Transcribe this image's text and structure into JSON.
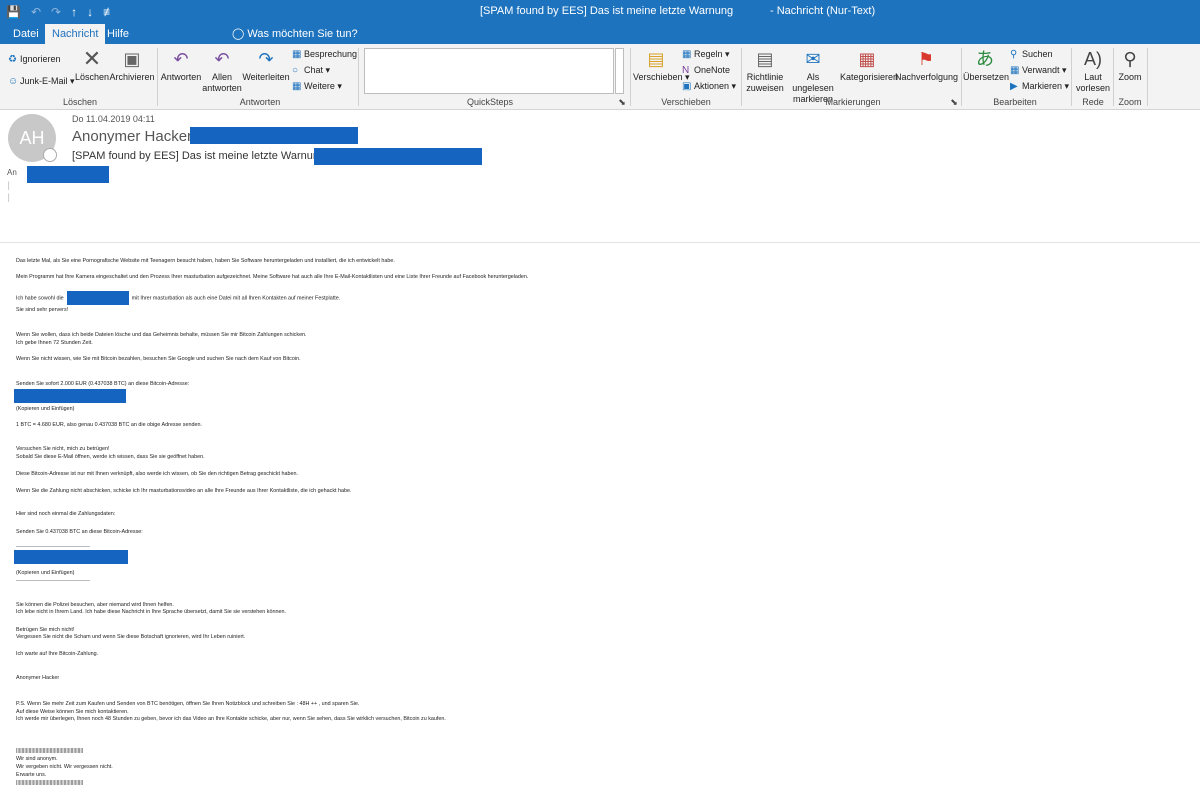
{
  "window": {
    "title_left": "[SPAM found by EES] Das ist meine letzte Warnung",
    "title_right": "-  Nachricht (Nur-Text)"
  },
  "qat": {
    "save": "💾",
    "undo": "↶",
    "redo": "↷",
    "up": "↑",
    "down": "↓",
    "more": "≢"
  },
  "menu": {
    "tabs": [
      "Datei",
      "Nachricht",
      "Hilfe"
    ],
    "tellme": "Was möchten Sie tun?"
  },
  "ribbon": {
    "loeschen": {
      "ignore": "Ignorieren",
      "junk": "Junk-E-Mail",
      "delete": "Löschen",
      "archive": "Archivieren",
      "label": "Löschen"
    },
    "antworten": {
      "reply": "Antworten",
      "reply_all": "Allen antworten",
      "forward": "Weiterleiten",
      "meeting": "Besprechung",
      "chat": "Chat",
      "more": "Weitere",
      "label": "Antworten"
    },
    "quicksteps": {
      "label": "QuickSteps"
    },
    "verschieben": {
      "move": "Verschieben",
      "rules": "Regeln",
      "onenote": "OneNote",
      "actions": "Aktionen",
      "label": "Verschieben"
    },
    "markierungen": {
      "policy": "Richtlinie zuweisen",
      "unread": "Als ungelesen markieren",
      "categorize": "Kategorisieren",
      "followup": "Nachverfolgung",
      "label": "Markierungen"
    },
    "bearbeiten": {
      "translate": "Übersetzen",
      "find": "Suchen",
      "related": "Verwandt",
      "select": "Markieren",
      "label": "Bearbeiten"
    },
    "rede": {
      "read_aloud": "Laut vorlesen",
      "label": "Rede"
    },
    "zoom": {
      "zoom": "Zoom",
      "label": "Zoom"
    }
  },
  "message": {
    "avatar_initials": "AH",
    "date": "Do 11.04.2019 04:11",
    "sender": "Anonymer Hacker",
    "subject": "[SPAM found by EES] Das ist meine letzte Warnung",
    "to_label": "An",
    "body": {
      "l1": "Das letzte Mal, als Sie eine Pornografische Website mit Teenagern besucht haben, haben Sie Software heruntergeladen und installiert, die ich entwickelt habe.",
      "l2": "Mein Programm hat Ihre Kamera eingeschaltet und den Prozess Ihrer masturbation aufgezeichnet. Meine Software hat auch alle Ihre E-Mail-Kontaktlisten und eine Liste Ihrer Freunde auf Facebook heruntergeladen.",
      "l3a": "Ich habe sowohl die",
      "l3b": "mit Ihrer masturbation als auch eine Datei mit all Ihren Kontakten auf meiner Festplatte.",
      "l4": "Sie sind sehr pervers!",
      "l5": "Wenn Sie wollen, dass ich beide Dateien lösche und das Geheimnis behalte, müssen Sie mir Bitcoin Zahlungen schicken.",
      "l6": "Ich gebe Ihnen 72 Stunden Zeit.",
      "l7": "Wenn Sie nicht wissen, wie Sie mit Bitcoin bezahlen, besuchen Sie Google und suchen Sie nach dem Kauf von Bitcoin.",
      "l8": "Senden Sie sofort 2.000 EUR (0.437038 BTC) an diese Bitcoin-Adresse:",
      "l9": "(Kopieren und Einfügen)",
      "l10": "1 BTC = 4.680 EUR, also genau 0.437038 BTC an die obige Adresse senden.",
      "l11": "Versuchen Sie nicht, mich zu betrügen!",
      "l12": "Sobald Sie diese E-Mail öffnen, werde ich wissen, dass Sie sie geöffnet haben.",
      "l13": "Diese Bitcoin-Adresse ist nur mit Ihnen verknüpft, also werde ich wissen, ob Sie den richtigen Betrag geschickt haben.",
      "l14": "Wenn Sie die Zahlung nicht abschicken, schicke ich Ihr masturbationsvideo an alle Ihre Freunde aus Ihrer Kontaktliste, die ich gehackt habe.",
      "l15": "Hier sind noch einmal die Zahlungsdaten:",
      "l16": "Senden Sie 0.437038 BTC an diese Bitcoin-Adresse:",
      "l17": "(Kopieren und Einfügen)",
      "l18": "Sie können die Polizei besuchen, aber niemand wird Ihnen helfen.",
      "l19": "Ich lebe nicht in Ihrem Land. Ich habe diese Nachricht in Ihre Sprache übersetzt, damit Sie sie verstehen können.",
      "l20": "Betrügen Sie mich nicht!",
      "l21": "Vergessen Sie nicht die Scham und wenn Sie diese Botschaft ignorieren, wird Ihr Leben ruiniert.",
      "l22": "Ich warte auf Ihre Bitcoin-Zahlung.",
      "l23": "Anonymer Hacker",
      "l24": "P.S. Wenn Sie mehr Zeit zum Kaufen und Senden von BTC benötigen,  öffnen Sie Ihren Notizblock und schreiben Sie : 48H ++ , und sparen Sie.",
      "l25": "Auf diese Weise können Sie mich kontaktieren.",
      "l26": "Ich werde mir überlegen, Ihnen noch 48 Stunden zu geben,  bevor ich das Video an Ihre Kontakte schicke, aber nur, wenn Sie sehen, dass Sie wirklich versuchen, Bitcoin zu kaufen.",
      "l27": "||||||||||||||||||||||||||||||||||||||||||||||||",
      "l28": "Wir sind anonym.",
      "l29": "Wir vergeben nicht. Wir vergessen nicht.",
      "l30": "Erwarte uns.",
      "l31": "||||||||||||||||||||||||||||||||||||||||||||||||"
    }
  },
  "colors": {
    "accent": "#1e73be",
    "redaction": "#1565c0"
  }
}
